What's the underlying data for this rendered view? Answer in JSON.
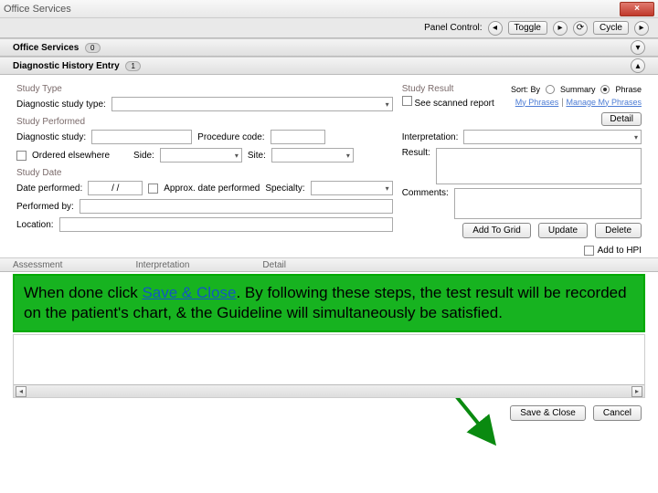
{
  "titlebar": {
    "left": "Office Services",
    "close": "×"
  },
  "panel_control": {
    "label": "Panel Control:",
    "toggle": "Toggle",
    "cycle": "Cycle"
  },
  "sections": {
    "office_services": {
      "title": "Office Services",
      "count": "0"
    },
    "diag_history": {
      "title": "Diagnostic History Entry",
      "count": "1"
    }
  },
  "left": {
    "study_type_lbl": "Study Type",
    "diag_study_type": "Diagnostic study type:",
    "study_performed_lbl": "Study Performed",
    "diag_study": "Diagnostic study:",
    "procedure_code": "Procedure code:",
    "ordered_elsewhere": "Ordered elsewhere",
    "side": "Side:",
    "site": "Site:",
    "study_date_lbl": "Study Date",
    "date_performed": "Date performed:",
    "date_value": "/ /",
    "approx": "Approx. date performed",
    "specialty": "Specialty:",
    "performed_by": "Performed by:",
    "location": "Location:"
  },
  "right": {
    "study_result": "Study Result",
    "sort_by": "Sort: By",
    "summary": "Summary",
    "phrase": "Phrase",
    "see_scanned": "See scanned report",
    "my_phrases": "My Phrases",
    "manage_phrases": "Manage My Phrases",
    "detail": "Detail",
    "interpretation": "Interpretation:",
    "result": "Result:",
    "comments": "Comments:"
  },
  "buttons": {
    "add_grid": "Add To Grid",
    "update": "Update",
    "delete": "Delete",
    "add_hpi": "Add to HPI",
    "save_close": "Save & Close",
    "cancel": "Cancel"
  },
  "columns": {
    "col1": "Assessment",
    "col2": "Interpretation",
    "col3": "Detail"
  },
  "callout": {
    "pre": "When done click ",
    "link": "Save & Close",
    "post": ".  By following these steps, the test result will be recorded on the patient's chart, & the Guideline will simultaneously be satisfied."
  }
}
